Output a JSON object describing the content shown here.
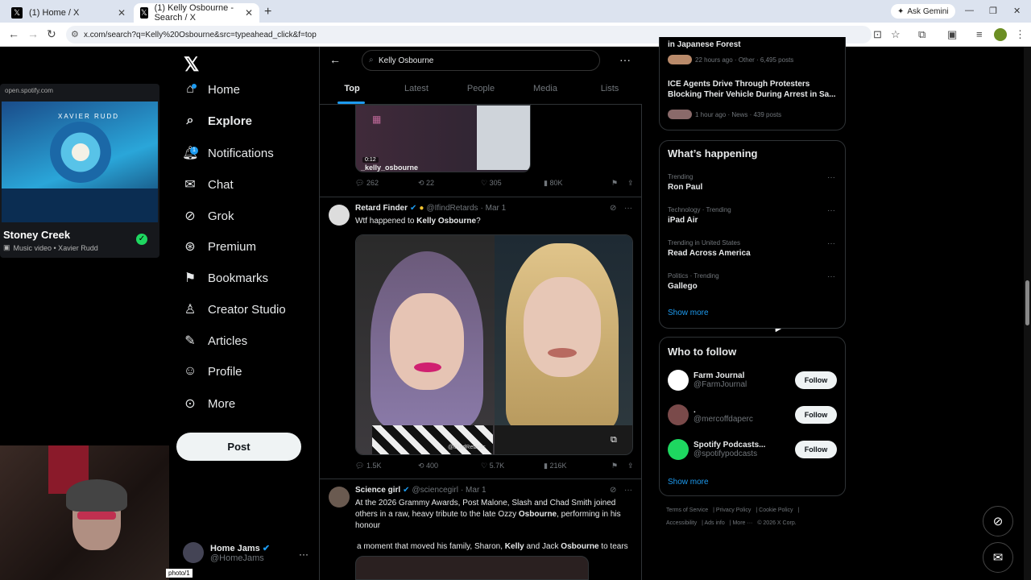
{
  "browser": {
    "tabs": [
      {
        "title": "(1) Home / X",
        "active": false
      },
      {
        "title": "(1) Kelly Osbourne - Search / X",
        "active": true
      }
    ],
    "ask_gemini": "Ask Gemini",
    "url": "x.com/search?q=Kelly%20Osbourne&src=typeahead_click&f=top",
    "status_tooltip": "photo/1"
  },
  "spotify": {
    "source": "open.spotify.com",
    "art_text": "XAVIER RUDD",
    "title": "Stoney Creek",
    "subtitle": "Music video • Xavier Rudd"
  },
  "nav": {
    "items": [
      {
        "label": "Home",
        "icon": "home-icon",
        "glyph": "⌂"
      },
      {
        "label": "Explore",
        "icon": "search-icon",
        "glyph": "⌕"
      },
      {
        "label": "Notifications",
        "icon": "bell-icon",
        "glyph": "🔔︎"
      },
      {
        "label": "Chat",
        "icon": "mail-icon",
        "glyph": "✉"
      },
      {
        "label": "Grok",
        "icon": "grok-icon",
        "glyph": "⊘"
      },
      {
        "label": "Premium",
        "icon": "premium-icon",
        "glyph": "⊛"
      },
      {
        "label": "Bookmarks",
        "icon": "bookmark-icon",
        "glyph": "⚑"
      },
      {
        "label": "Creator Studio",
        "icon": "creator-icon",
        "glyph": "♙"
      },
      {
        "label": "Articles",
        "icon": "article-icon",
        "glyph": "✎"
      },
      {
        "label": "Profile",
        "icon": "profile-icon",
        "glyph": "☺"
      },
      {
        "label": "More",
        "icon": "more-icon",
        "glyph": "⊙"
      }
    ],
    "notifications_count": "1",
    "post_label": "Post",
    "account": {
      "name": "Home Jams",
      "handle": "@HomeJams"
    }
  },
  "search": {
    "query": "Kelly Osbourne",
    "tabs": [
      "Top",
      "Latest",
      "People",
      "Media",
      "Lists"
    ]
  },
  "tweets": {
    "prev": {
      "video_time": "0:12",
      "video_caption": "_kelly_osbourne",
      "replies": "262",
      "reposts": "22",
      "likes": "305",
      "views": "80K"
    },
    "t1": {
      "name": "Retard Finder",
      "handle": "@IfindRetards",
      "date": "· Mar 1",
      "text_pre": "Wtf happened to ",
      "text_bold": "Kelly Osbourne",
      "text_post": "?",
      "watermark": "@iFindRetards",
      "replies": "1.5K",
      "reposts": "400",
      "likes": "5.7K",
      "views": "216K"
    },
    "t2": {
      "name": "Science girl",
      "handle": "@sciencegirl",
      "date": "· Mar 1",
      "line1": "At the 2026 Grammy Awards, Post Malone, Slash and Chad Smith joined",
      "line2a": "others in a raw, heavy tribute to the late Ozzy ",
      "line2b": "Osbourne",
      "line2c": ", performing in his",
      "line3": "honour",
      "line4a": "a moment that moved his family, Sharon, ",
      "line4b": "Kelly",
      "line4c": " and Jack ",
      "line4d": "Osbourne",
      "line4e": " to tears"
    }
  },
  "sidebar": {
    "top_trends": [
      {
        "name": "in Japanese Forest",
        "meta": "22 hours ago · Other · 6,495 posts"
      },
      {
        "name": "ICE Agents Drive Through Protesters Blocking Their Vehicle During Arrest in Sa...",
        "meta": "1 hour ago · News · 439 posts"
      }
    ],
    "whats_happening": {
      "title": "What’s happening",
      "trends": [
        {
          "meta": "Trending",
          "name": "Ron Paul"
        },
        {
          "meta": "Technology · Trending",
          "name": "iPad Air"
        },
        {
          "meta": "Trending in United States",
          "name": "Read Across America"
        },
        {
          "meta": "Politics · Trending",
          "name": "Gallego"
        }
      ],
      "show_more": "Show more"
    },
    "who_to_follow": {
      "title": "Who to follow",
      "accounts": [
        {
          "name": "Farm Journal",
          "handle": "@FarmJournal",
          "avatar_color": "#ffffff"
        },
        {
          "name": ".",
          "handle": "@mercoffdaperc",
          "avatar_color": "#7a4a4a"
        },
        {
          "name": "Spotify Podcasts...",
          "handle": "@spotifypodcasts",
          "avatar_color": "#1ed760"
        }
      ],
      "follow_label": "Follow",
      "show_more": "Show more"
    },
    "footer": [
      "Terms of Service",
      "Privacy Policy",
      "Cookie Policy",
      "Accessibility",
      "Ads info",
      "More ···",
      "© 2026 X Corp."
    ]
  },
  "colors": {
    "accent": "#1d9bf0",
    "bg": "#000000",
    "text": "#e7e9ea",
    "muted": "#71767b"
  }
}
